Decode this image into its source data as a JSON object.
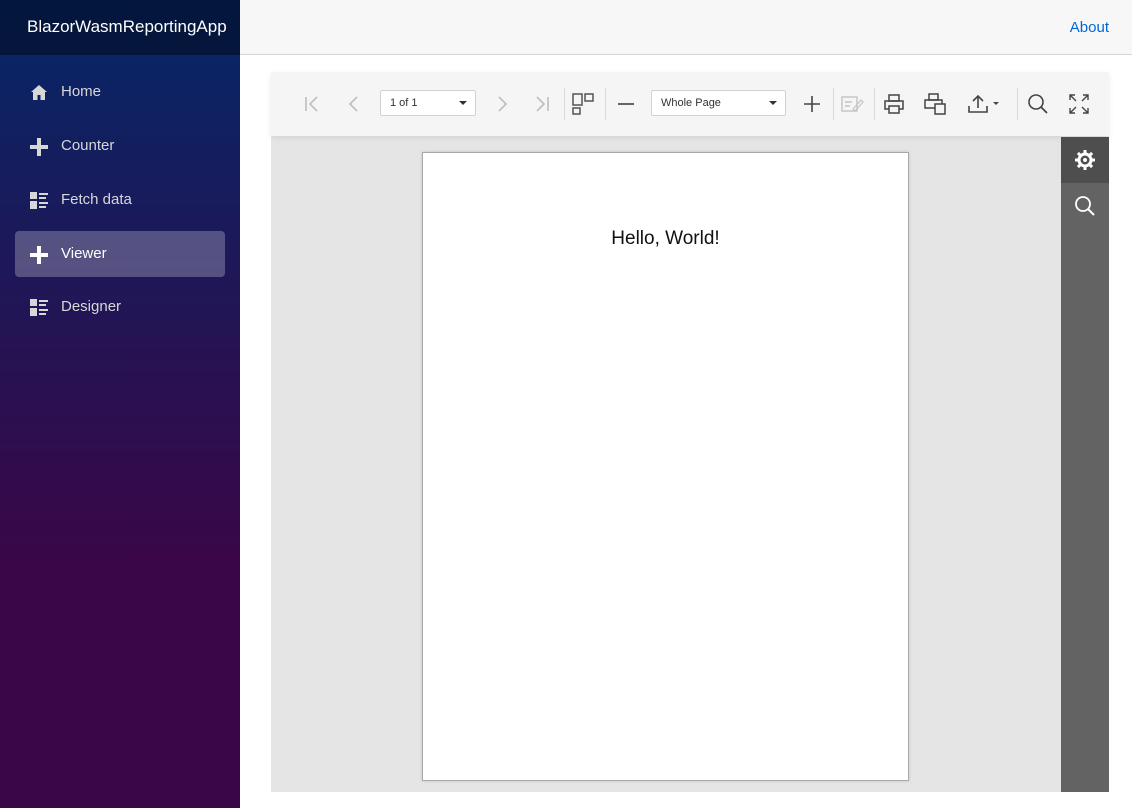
{
  "app": {
    "title": "BlazorWasmReportingApp"
  },
  "nav": {
    "items": [
      {
        "label": "Home",
        "icon": "home-icon",
        "active": false
      },
      {
        "label": "Counter",
        "icon": "plus-icon",
        "active": false
      },
      {
        "label": "Fetch data",
        "icon": "list-icon",
        "active": false
      },
      {
        "label": "Viewer",
        "icon": "plus-icon",
        "active": true
      },
      {
        "label": "Designer",
        "icon": "list-icon",
        "active": false
      }
    ]
  },
  "header": {
    "about_label": "About"
  },
  "toolbar": {
    "page_selector": "1 of 1",
    "zoom_selector": "Whole Page"
  },
  "report": {
    "text": "Hello, World!"
  },
  "colors": {
    "sidebar_top": "#052767",
    "sidebar_bottom": "#3a0647",
    "link": "#0366d6",
    "panel": "#636363"
  }
}
